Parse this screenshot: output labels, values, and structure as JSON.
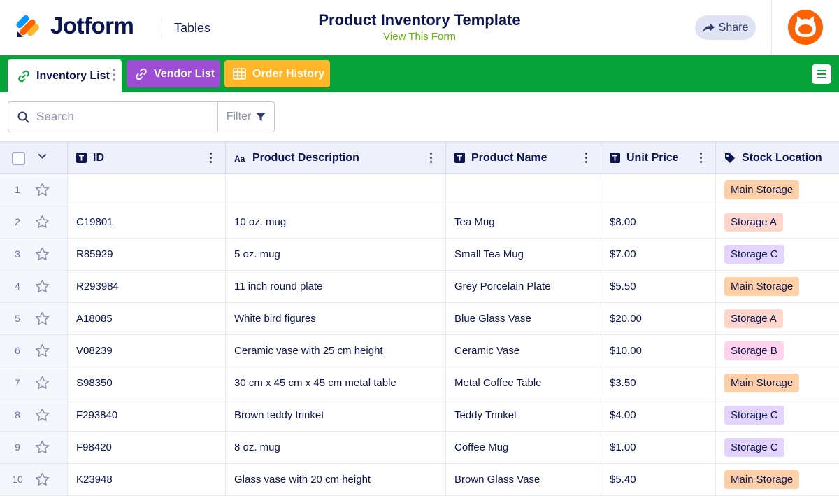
{
  "header": {
    "brand": "Jotform",
    "section": "Tables",
    "title": "Product Inventory Template",
    "view_link": "View This Form",
    "share_label": "Share"
  },
  "tabs": [
    {
      "label": "Inventory List",
      "icon": "link-icon",
      "color": "#ffffff"
    },
    {
      "label": "Vendor List",
      "icon": "link-icon",
      "color": "#9c4dd3"
    },
    {
      "label": "Order History",
      "icon": "grid-icon",
      "color": "#ffb629"
    }
  ],
  "toolbar": {
    "search_placeholder": "Search",
    "filter_label": "Filter"
  },
  "columns": [
    {
      "label": "ID",
      "icon": "text-type-icon"
    },
    {
      "label": "Product Description",
      "icon": "aa-type-icon"
    },
    {
      "label": "Product Name",
      "icon": "text-type-icon"
    },
    {
      "label": "Unit Price",
      "icon": "text-type-icon"
    },
    {
      "label": "Stock Location",
      "icon": "tag-icon"
    }
  ],
  "rows": [
    {
      "num": "1",
      "id": "",
      "desc": "",
      "name": "",
      "price": "",
      "location": "Main Storage"
    },
    {
      "num": "2",
      "id": "C19801",
      "desc": "10 oz. mug",
      "name": "Tea Mug",
      "price": "$8.00",
      "location": "Storage A"
    },
    {
      "num": "3",
      "id": "R85929",
      "desc": "5 oz. mug",
      "name": "Small Tea Mug",
      "price": "$7.00",
      "location": "Storage C"
    },
    {
      "num": "4",
      "id": "R293984",
      "desc": "11 inch round plate",
      "name": "Grey Porcelain Plate",
      "price": "$5.50",
      "location": "Main Storage"
    },
    {
      "num": "5",
      "id": "A18085",
      "desc": "White bird figures",
      "name": "Blue Glass Vase",
      "price": "$20.00",
      "location": "Storage A"
    },
    {
      "num": "6",
      "id": "V08239",
      "desc": "Ceramic vase with 25 cm height",
      "name": "Ceramic Vase",
      "price": "$10.00",
      "location": "Storage B"
    },
    {
      "num": "7",
      "id": "S98350",
      "desc": "30 cm x 45 cm x 45 cm metal table",
      "name": "Metal Coffee Table",
      "price": "$3.50",
      "location": "Main Storage"
    },
    {
      "num": "8",
      "id": "F293840",
      "desc": "Brown teddy trinket",
      "name": "Teddy Trinket",
      "price": "$4.00",
      "location": "Storage C"
    },
    {
      "num": "9",
      "id": "F98420",
      "desc": "8 oz. mug",
      "name": "Coffee Mug",
      "price": "$1.00",
      "location": "Storage C"
    },
    {
      "num": "10",
      "id": "K23948",
      "desc": "Glass vase with 20 cm height",
      "name": "Brown Glass Vase",
      "price": "$5.40",
      "location": "Main Storage"
    }
  ],
  "location_colors": {
    "Main Storage": "#ffd0a8",
    "Storage A": "#ffd6cc",
    "Storage B": "#ffd3ec",
    "Storage C": "#e3d4fb"
  },
  "colors": {
    "tabbar": "#06a33a",
    "view_link": "#64b200",
    "avatar": "#ff6100"
  }
}
